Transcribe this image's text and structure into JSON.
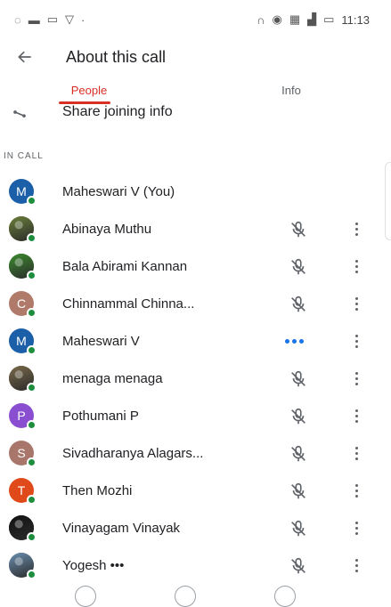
{
  "status_bar": {
    "left_icons": [
      "sim-icon",
      "message-icon",
      "image-icon",
      "shield-icon",
      "dot-icon"
    ],
    "right_icons": [
      "headphones-icon",
      "eye-icon",
      "network-icon",
      "signal-icon",
      "battery-icon"
    ],
    "time": "11:13"
  },
  "header": {
    "title": "About this call",
    "back_icon": "back-arrow-icon"
  },
  "tabs": [
    {
      "label": "People",
      "active": true
    },
    {
      "label": "Info",
      "active": false
    }
  ],
  "share": {
    "label": "Share joining info",
    "icon": "share-icon"
  },
  "section": {
    "label": "IN CALL"
  },
  "participants": [
    {
      "name": "Maheswari V (You)",
      "avatar_initial": "M",
      "avatar_color": "#1a5fa8",
      "photo": false,
      "status": "none"
    },
    {
      "name": "Abinaya Muthu",
      "avatar_initial": "",
      "avatar_color": "#6a7f3a",
      "photo": true,
      "status": "muted"
    },
    {
      "name": "Bala Abirami Kannan",
      "avatar_initial": "",
      "avatar_color": "#3c8c2e",
      "photo": true,
      "status": "muted"
    },
    {
      "name": "Chinnammal Chinna...",
      "avatar_initial": "C",
      "avatar_color": "#b07a6a",
      "photo": false,
      "status": "muted"
    },
    {
      "name": "Maheswari V",
      "avatar_initial": "M",
      "avatar_color": "#1a5fa8",
      "photo": false,
      "status": "speaking"
    },
    {
      "name": "menaga menaga",
      "avatar_initial": "",
      "avatar_color": "#7a6a4a",
      "photo": true,
      "status": "muted"
    },
    {
      "name": "Pothumani P",
      "avatar_initial": "P",
      "avatar_color": "#8a4fd0",
      "photo": false,
      "status": "muted"
    },
    {
      "name": "Sivadharanya Alagars...",
      "avatar_initial": "S",
      "avatar_color": "#a8766a",
      "photo": false,
      "status": "muted"
    },
    {
      "name": "Then Mozhi",
      "avatar_initial": "T",
      "avatar_color": "#e04a1a",
      "photo": false,
      "status": "muted"
    },
    {
      "name": "Vinayagam Vinayak",
      "avatar_initial": "",
      "avatar_color": "#111111",
      "photo": true,
      "status": "muted"
    },
    {
      "name": "Yogesh •••",
      "avatar_initial": "",
      "avatar_color": "#6a8fb0",
      "photo": true,
      "status": "muted"
    }
  ],
  "colors": {
    "accent": "#d93025",
    "presence": "#1e8e3e",
    "speaking": "#1a73e8"
  }
}
